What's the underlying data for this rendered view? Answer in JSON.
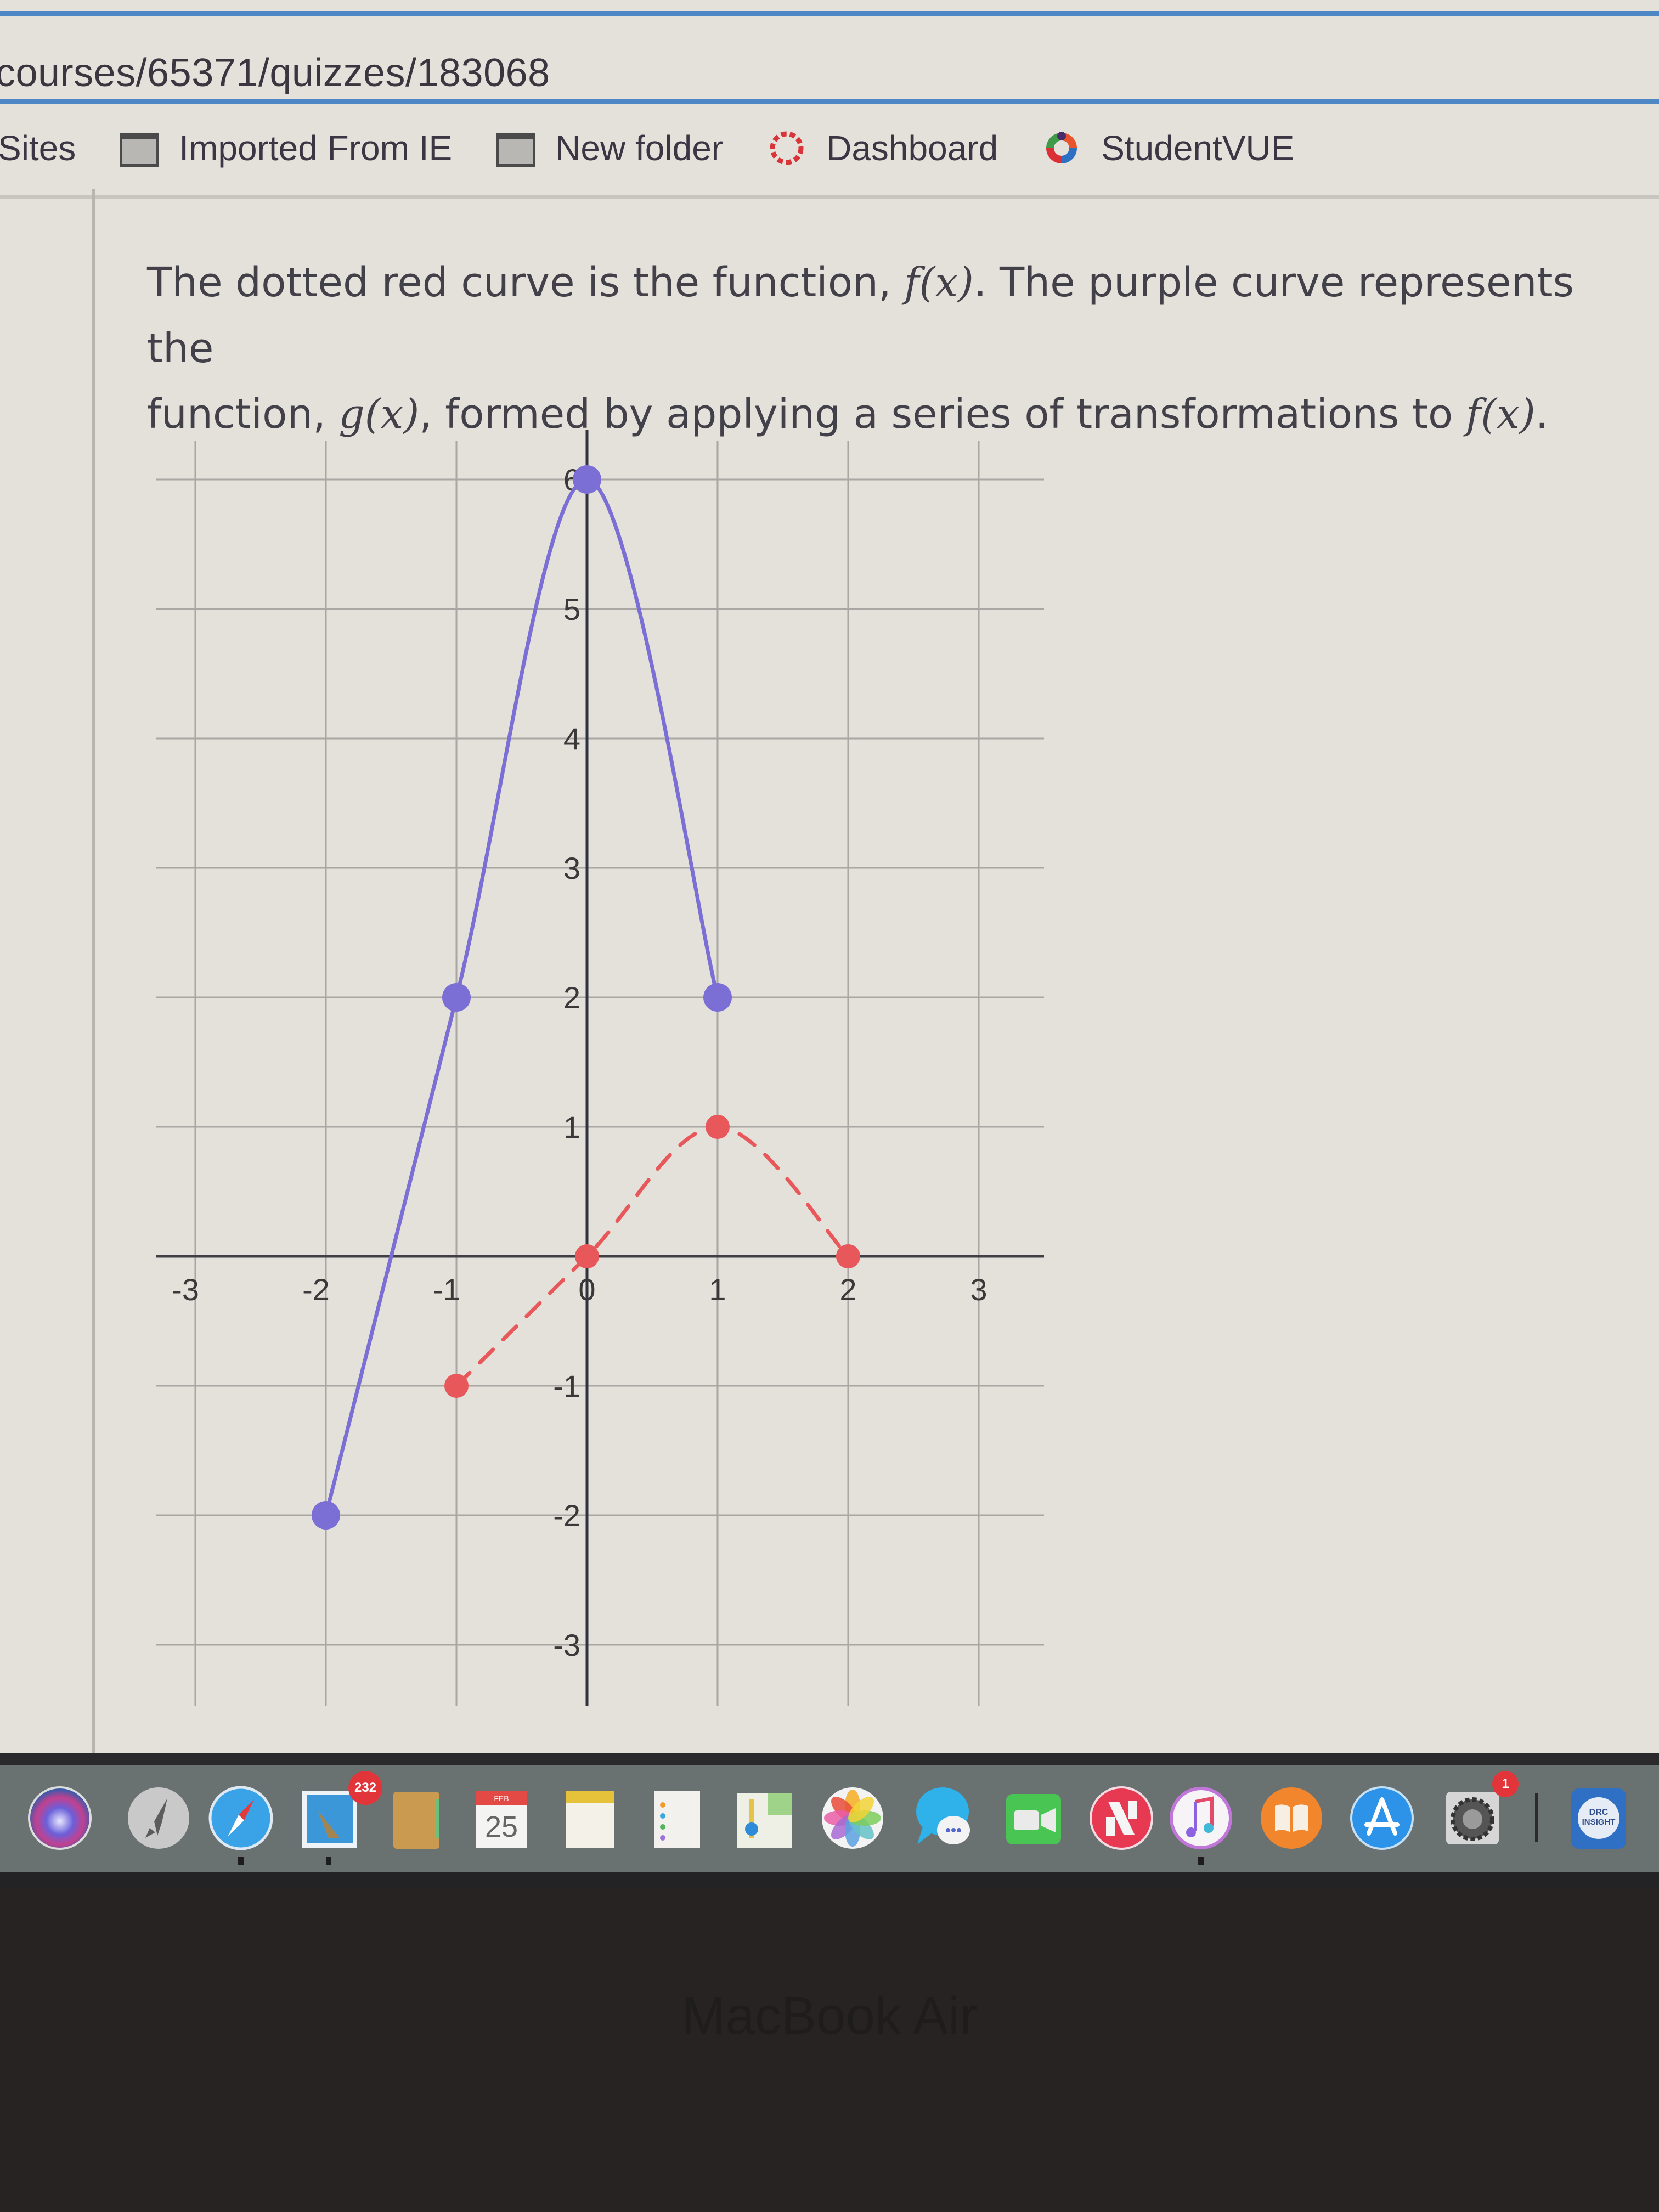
{
  "browser": {
    "url": "courses/65371/quizzes/183068",
    "bookmarks": [
      {
        "label": "Sites",
        "icon": "none"
      },
      {
        "label": "Imported From IE",
        "icon": "folder-icon"
      },
      {
        "label": "New folder",
        "icon": "folder-icon"
      },
      {
        "label": "Dashboard",
        "icon": "canvas-logo-icon"
      },
      {
        "label": "StudentVUE",
        "icon": "studentvue-logo-icon"
      }
    ]
  },
  "question": {
    "line1_pre": "The dotted red curve is the function, ",
    "line1_fx": "f(x)",
    "line1_post": ". The purple curve represents the",
    "line2_pre": "function, ",
    "line2_gx": "g(x)",
    "line2_mid": ", formed by applying a series of transformations to ",
    "line2_fx": "f(x)",
    "line2_post": "."
  },
  "chart_data": {
    "type": "line",
    "title": "",
    "xlabel": "",
    "ylabel": "",
    "xlim": [
      -3.3,
      3.5
    ],
    "ylim": [
      -3.5,
      6.3
    ],
    "grid": true,
    "x_ticks": [
      -3,
      -2,
      -1,
      0,
      1,
      2,
      3
    ],
    "y_ticks": [
      -3,
      -2,
      -1,
      1,
      2,
      3,
      4,
      5,
      6
    ],
    "series": [
      {
        "name": "f(x)",
        "style": "dashed",
        "color": "#e8585a",
        "points": [
          [
            -1,
            -1
          ],
          [
            0,
            0
          ],
          [
            1,
            1
          ],
          [
            2,
            0
          ]
        ]
      },
      {
        "name": "g(x)",
        "style": "solid",
        "color": "#7b6fd6",
        "points": [
          [
            -2,
            -2
          ],
          [
            -1,
            2
          ],
          [
            0,
            6
          ],
          [
            1,
            2
          ]
        ]
      }
    ]
  },
  "dock": {
    "items": [
      {
        "name": "siri",
        "icon": "siri-icon"
      },
      {
        "name": "launchpad",
        "icon": "launchpad-rocket-icon"
      },
      {
        "name": "safari",
        "icon": "safari-compass-icon",
        "running": true
      },
      {
        "name": "mail",
        "icon": "mail-stamp-icon",
        "badge": "232",
        "running": true
      },
      {
        "name": "contacts",
        "icon": "contacts-book-icon"
      },
      {
        "name": "calendar",
        "icon": "calendar-icon",
        "month": "FEB",
        "day": "25"
      },
      {
        "name": "notes",
        "icon": "notes-icon"
      },
      {
        "name": "reminders",
        "icon": "reminders-icon"
      },
      {
        "name": "maps",
        "icon": "maps-icon"
      },
      {
        "name": "photos",
        "icon": "photos-pinwheel-icon"
      },
      {
        "name": "messages",
        "icon": "messages-bubble-icon"
      },
      {
        "name": "facetime",
        "icon": "facetime-camera-icon"
      },
      {
        "name": "news",
        "icon": "news-icon"
      },
      {
        "name": "itunes",
        "icon": "music-note-icon",
        "running": true
      },
      {
        "name": "books",
        "icon": "books-icon"
      },
      {
        "name": "app-store",
        "icon": "app-store-icon"
      },
      {
        "name": "system-preferences",
        "icon": "gear-icon",
        "badge": "1"
      },
      {
        "name": "drc-insight",
        "icon": "drc-insight-icon",
        "label": "DRC INSIGHT"
      }
    ]
  },
  "device_label": "MacBook Air"
}
